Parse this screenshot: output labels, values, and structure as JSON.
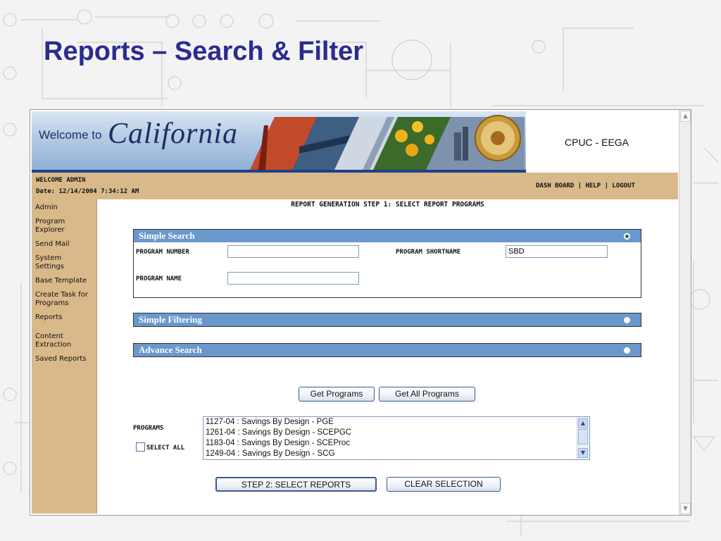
{
  "slide": {
    "title": "Reports – Search & Filter"
  },
  "banner": {
    "welcome_text": "Welcome to",
    "state_text": "California",
    "site_name": "CPUC - EEGA"
  },
  "user_bar": {
    "welcome": "WELCOME ADMIN",
    "date": "Date: 12/14/2004 7:34:12 AM",
    "links": [
      "DASH BOARD",
      "HELP",
      "LOGOUT"
    ],
    "separator": "|"
  },
  "sidebar": {
    "items": [
      {
        "label": "Admin"
      },
      {
        "label": "Program Explorer"
      },
      {
        "label": "Send Mail"
      },
      {
        "label": "System Settings"
      },
      {
        "label": "Base Template"
      },
      {
        "label": "Create Task for Programs"
      },
      {
        "label": "Reports"
      },
      {
        "label": "Content Extraction"
      },
      {
        "label": "Saved Reports"
      }
    ]
  },
  "main": {
    "step_title": "REPORT GENERATION STEP 1: SELECT REPORT PROGRAMS",
    "simple_search": {
      "title": "Simple Search",
      "program_number_label": "PROGRAM NUMBER",
      "program_number_value": "",
      "program_shortname_label": "PROGRAM SHORTNAME",
      "program_shortname_value": "SBD",
      "program_name_label": "PROGRAM NAME",
      "program_name_value": "",
      "selected": true
    },
    "simple_filtering": {
      "title": "Simple Filtering",
      "selected": false
    },
    "advance_search": {
      "title": "Advance Search",
      "selected": false
    },
    "buttons": {
      "get_programs": "Get Programs",
      "get_all_programs": "Get All Programs",
      "step2": "STEP 2: SELECT REPORTS",
      "clear_selection": "CLEAR SELECTION"
    },
    "programs_label": "PROGRAMS",
    "select_all_label": "SELECT ALL",
    "programs": [
      "1127-04 : Savings By Design - PGE",
      "1261-04 : Savings By Design - SCEPGC",
      "1183-04 : Savings By Design - SCEProc",
      "1249-04 : Savings By Design - SCG"
    ]
  },
  "colors": {
    "title_blue": "#2b2b8f",
    "panel_header": "#6a98cc",
    "sidebar_tan": "#d9b98a"
  }
}
